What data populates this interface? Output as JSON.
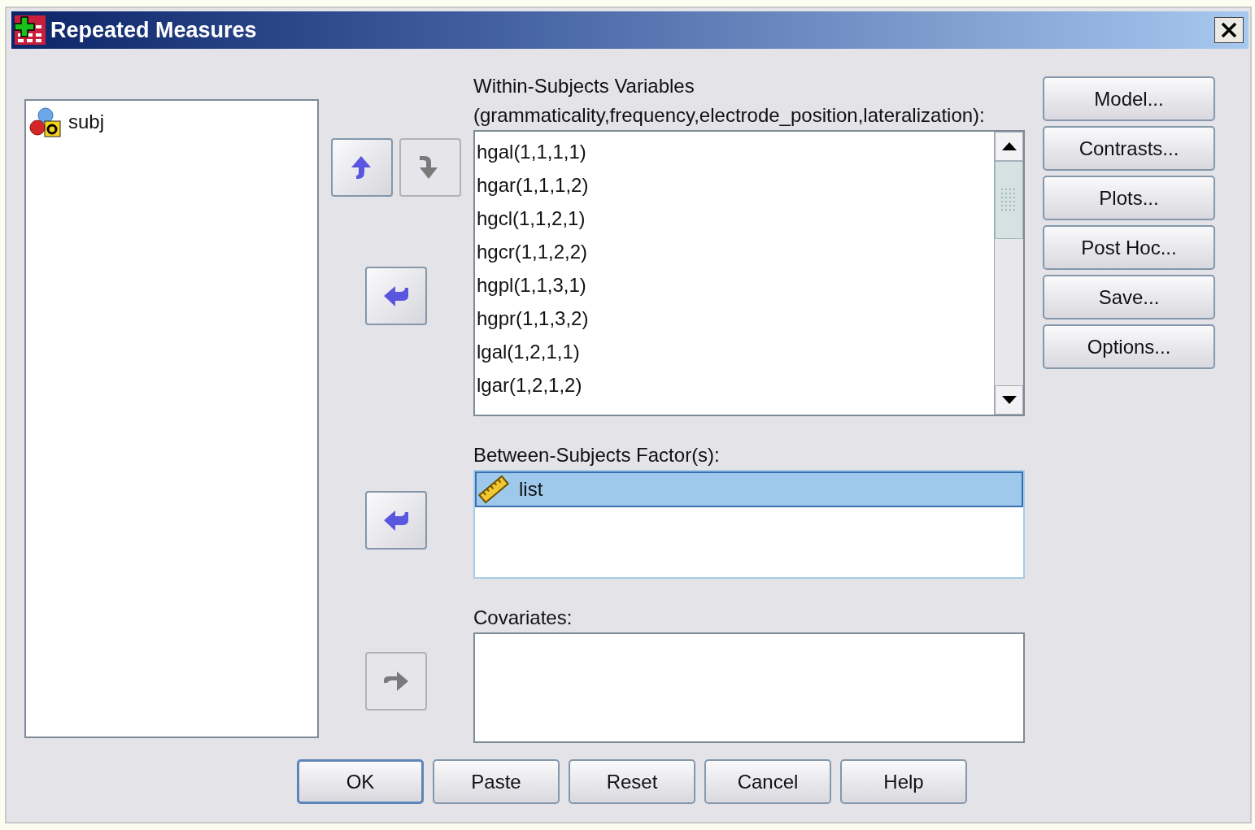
{
  "window": {
    "title": "Repeated Measures"
  },
  "source_list": {
    "items": [
      {
        "name": "subj",
        "kind": "string",
        "selected": false
      }
    ]
  },
  "within_subjects": {
    "label": "Within-Subjects Variables",
    "factors": "(grammaticality,frequency,electrode_position,lateralization):",
    "reorder_buttons": [
      {
        "kind": "up",
        "disabled": false
      },
      {
        "kind": "down",
        "disabled": true
      }
    ],
    "transfer_button": {
      "kind": "left",
      "disabled": false
    },
    "items": [
      {
        "name": "hgal(1,1,1,1)",
        "selected": false
      },
      {
        "name": "hgar(1,1,1,2)",
        "selected": false
      },
      {
        "name": "hgcl(1,1,2,1)",
        "selected": false
      },
      {
        "name": "hgcr(1,1,2,2)",
        "selected": false
      },
      {
        "name": "hgpl(1,1,3,1)",
        "selected": false
      },
      {
        "name": "hgpr(1,1,3,2)",
        "selected": false
      },
      {
        "name": "lgal(1,2,1,1)",
        "selected": false
      },
      {
        "name": "lgar(1,2,1,2)",
        "selected": false
      }
    ]
  },
  "between_subjects": {
    "label": "Between-Subjects Factor(s):",
    "transfer_button": {
      "kind": "left",
      "disabled": false
    },
    "items": [
      {
        "name": "list",
        "kind": "scale",
        "selected": true
      }
    ]
  },
  "covariates": {
    "label": "Covariates:",
    "transfer_button": {
      "kind": "right",
      "disabled": true
    }
  },
  "side_buttons": [
    "Model...",
    "Contrasts...",
    "Plots...",
    "Post Hoc...",
    "Save...",
    "Options..."
  ],
  "footer_buttons": [
    {
      "label": "OK",
      "default": true
    },
    {
      "label": "Paste",
      "default": false
    },
    {
      "label": "Reset",
      "default": false
    },
    {
      "label": "Cancel",
      "default": false
    },
    {
      "label": "Help",
      "default": false
    }
  ]
}
